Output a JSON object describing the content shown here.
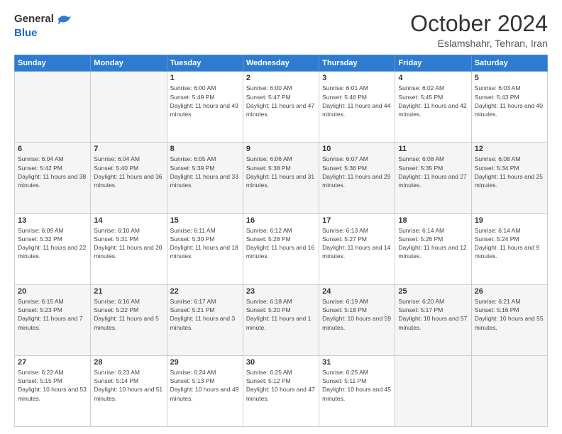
{
  "logo": {
    "general": "General",
    "blue": "Blue"
  },
  "header": {
    "month": "October 2024",
    "location": "Eslamshahr, Tehran, Iran"
  },
  "weekdays": [
    "Sunday",
    "Monday",
    "Tuesday",
    "Wednesday",
    "Thursday",
    "Friday",
    "Saturday"
  ],
  "weeks": [
    [
      {
        "day": "",
        "sunrise": "",
        "sunset": "",
        "daylight": ""
      },
      {
        "day": "",
        "sunrise": "",
        "sunset": "",
        "daylight": ""
      },
      {
        "day": "1",
        "sunrise": "Sunrise: 6:00 AM",
        "sunset": "Sunset: 5:49 PM",
        "daylight": "Daylight: 11 hours and 49 minutes."
      },
      {
        "day": "2",
        "sunrise": "Sunrise: 6:00 AM",
        "sunset": "Sunset: 5:47 PM",
        "daylight": "Daylight: 11 hours and 47 minutes."
      },
      {
        "day": "3",
        "sunrise": "Sunrise: 6:01 AM",
        "sunset": "Sunset: 5:46 PM",
        "daylight": "Daylight: 11 hours and 44 minutes."
      },
      {
        "day": "4",
        "sunrise": "Sunrise: 6:02 AM",
        "sunset": "Sunset: 5:45 PM",
        "daylight": "Daylight: 11 hours and 42 minutes."
      },
      {
        "day": "5",
        "sunrise": "Sunrise: 6:03 AM",
        "sunset": "Sunset: 5:43 PM",
        "daylight": "Daylight: 11 hours and 40 minutes."
      }
    ],
    [
      {
        "day": "6",
        "sunrise": "Sunrise: 6:04 AM",
        "sunset": "Sunset: 5:42 PM",
        "daylight": "Daylight: 11 hours and 38 minutes."
      },
      {
        "day": "7",
        "sunrise": "Sunrise: 6:04 AM",
        "sunset": "Sunset: 5:40 PM",
        "daylight": "Daylight: 11 hours and 36 minutes."
      },
      {
        "day": "8",
        "sunrise": "Sunrise: 6:05 AM",
        "sunset": "Sunset: 5:39 PM",
        "daylight": "Daylight: 11 hours and 33 minutes."
      },
      {
        "day": "9",
        "sunrise": "Sunrise: 6:06 AM",
        "sunset": "Sunset: 5:38 PM",
        "daylight": "Daylight: 11 hours and 31 minutes."
      },
      {
        "day": "10",
        "sunrise": "Sunrise: 6:07 AM",
        "sunset": "Sunset: 5:36 PM",
        "daylight": "Daylight: 11 hours and 29 minutes."
      },
      {
        "day": "11",
        "sunrise": "Sunrise: 6:08 AM",
        "sunset": "Sunset: 5:35 PM",
        "daylight": "Daylight: 11 hours and 27 minutes."
      },
      {
        "day": "12",
        "sunrise": "Sunrise: 6:08 AM",
        "sunset": "Sunset: 5:34 PM",
        "daylight": "Daylight: 11 hours and 25 minutes."
      }
    ],
    [
      {
        "day": "13",
        "sunrise": "Sunrise: 6:09 AM",
        "sunset": "Sunset: 5:32 PM",
        "daylight": "Daylight: 11 hours and 22 minutes."
      },
      {
        "day": "14",
        "sunrise": "Sunrise: 6:10 AM",
        "sunset": "Sunset: 5:31 PM",
        "daylight": "Daylight: 11 hours and 20 minutes."
      },
      {
        "day": "15",
        "sunrise": "Sunrise: 6:11 AM",
        "sunset": "Sunset: 5:30 PM",
        "daylight": "Daylight: 11 hours and 18 minutes."
      },
      {
        "day": "16",
        "sunrise": "Sunrise: 6:12 AM",
        "sunset": "Sunset: 5:28 PM",
        "daylight": "Daylight: 11 hours and 16 minutes."
      },
      {
        "day": "17",
        "sunrise": "Sunrise: 6:13 AM",
        "sunset": "Sunset: 5:27 PM",
        "daylight": "Daylight: 11 hours and 14 minutes."
      },
      {
        "day": "18",
        "sunrise": "Sunrise: 6:14 AM",
        "sunset": "Sunset: 5:26 PM",
        "daylight": "Daylight: 11 hours and 12 minutes."
      },
      {
        "day": "19",
        "sunrise": "Sunrise: 6:14 AM",
        "sunset": "Sunset: 5:24 PM",
        "daylight": "Daylight: 11 hours and 9 minutes."
      }
    ],
    [
      {
        "day": "20",
        "sunrise": "Sunrise: 6:15 AM",
        "sunset": "Sunset: 5:23 PM",
        "daylight": "Daylight: 11 hours and 7 minutes."
      },
      {
        "day": "21",
        "sunrise": "Sunrise: 6:16 AM",
        "sunset": "Sunset: 5:22 PM",
        "daylight": "Daylight: 11 hours and 5 minutes."
      },
      {
        "day": "22",
        "sunrise": "Sunrise: 6:17 AM",
        "sunset": "Sunset: 5:21 PM",
        "daylight": "Daylight: 11 hours and 3 minutes."
      },
      {
        "day": "23",
        "sunrise": "Sunrise: 6:18 AM",
        "sunset": "Sunset: 5:20 PM",
        "daylight": "Daylight: 11 hours and 1 minute."
      },
      {
        "day": "24",
        "sunrise": "Sunrise: 6:19 AM",
        "sunset": "Sunset: 5:18 PM",
        "daylight": "Daylight: 10 hours and 59 minutes."
      },
      {
        "day": "25",
        "sunrise": "Sunrise: 6:20 AM",
        "sunset": "Sunset: 5:17 PM",
        "daylight": "Daylight: 10 hours and 57 minutes."
      },
      {
        "day": "26",
        "sunrise": "Sunrise: 6:21 AM",
        "sunset": "Sunset: 5:16 PM",
        "daylight": "Daylight: 10 hours and 55 minutes."
      }
    ],
    [
      {
        "day": "27",
        "sunrise": "Sunrise: 6:22 AM",
        "sunset": "Sunset: 5:15 PM",
        "daylight": "Daylight: 10 hours and 53 minutes."
      },
      {
        "day": "28",
        "sunrise": "Sunrise: 6:23 AM",
        "sunset": "Sunset: 5:14 PM",
        "daylight": "Daylight: 10 hours and 51 minutes."
      },
      {
        "day": "29",
        "sunrise": "Sunrise: 6:24 AM",
        "sunset": "Sunset: 5:13 PM",
        "daylight": "Daylight: 10 hours and 49 minutes."
      },
      {
        "day": "30",
        "sunrise": "Sunrise: 6:25 AM",
        "sunset": "Sunset: 5:12 PM",
        "daylight": "Daylight: 10 hours and 47 minutes."
      },
      {
        "day": "31",
        "sunrise": "Sunrise: 6:25 AM",
        "sunset": "Sunset: 5:11 PM",
        "daylight": "Daylight: 10 hours and 45 minutes."
      },
      {
        "day": "",
        "sunrise": "",
        "sunset": "",
        "daylight": ""
      },
      {
        "day": "",
        "sunrise": "",
        "sunset": "",
        "daylight": ""
      }
    ]
  ]
}
